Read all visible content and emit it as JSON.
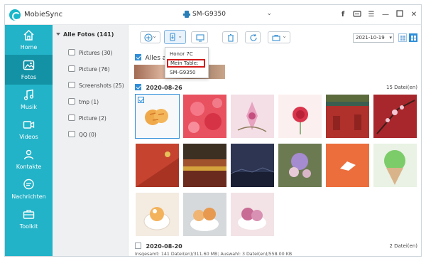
{
  "app": {
    "name": "MobieSync"
  },
  "device": {
    "name": "SM-G9350"
  },
  "window_controls": [
    "f",
    "chat",
    "menu",
    "minimize",
    "maximize",
    "close"
  ],
  "sidebar": {
    "items": [
      {
        "label": "Home",
        "icon": "home-icon",
        "active": false
      },
      {
        "label": "Fotos",
        "icon": "photo-icon",
        "active": true
      },
      {
        "label": "Musik",
        "icon": "music-icon",
        "active": false
      },
      {
        "label": "Videos",
        "icon": "video-icon",
        "active": false
      },
      {
        "label": "Kontakte",
        "icon": "contacts-icon",
        "active": false
      },
      {
        "label": "Nachrichten",
        "icon": "messages-icon",
        "active": false
      },
      {
        "label": "Toolkit",
        "icon": "toolkit-icon",
        "active": false
      }
    ]
  },
  "tree": {
    "root": "Alle Fotos (141)",
    "items": [
      {
        "label": "Pictures (30)"
      },
      {
        "label": "Picture (76)"
      },
      {
        "label": "Screenshots (25)"
      },
      {
        "label": "tmp (1)"
      },
      {
        "label": "Picture (2)"
      },
      {
        "label": "QQ (0)"
      }
    ]
  },
  "toolbar": {
    "buttons": [
      "add",
      "export-to-device",
      "export-to-pc",
      "delete",
      "refresh",
      "toolbox"
    ],
    "date_value": "2021-10-19"
  },
  "dropdown": {
    "items": [
      {
        "label": "Honor 7C",
        "highlight": false
      },
      {
        "label": "Mein Table:",
        "highlight": true
      },
      {
        "label": "SM-G9350",
        "highlight": false
      }
    ],
    "highlight_color": "#d61a1a"
  },
  "select_all": {
    "label": "Alles a"
  },
  "sections": [
    {
      "date": "2020-08-26",
      "count": "15 Datei(en)",
      "checked": true
    },
    {
      "date": "2020-08-20",
      "count": "2 Datei(en)",
      "checked": false
    }
  ],
  "status": "Insgesamt: 141 Datei(en)/311.60 MB; Auswahl: 3 Datei(en)/558.00 KB",
  "colors": {
    "sidebar": "#22b3c8",
    "sidebar_active": "#1392a6",
    "accent": "#2f8ed8"
  }
}
